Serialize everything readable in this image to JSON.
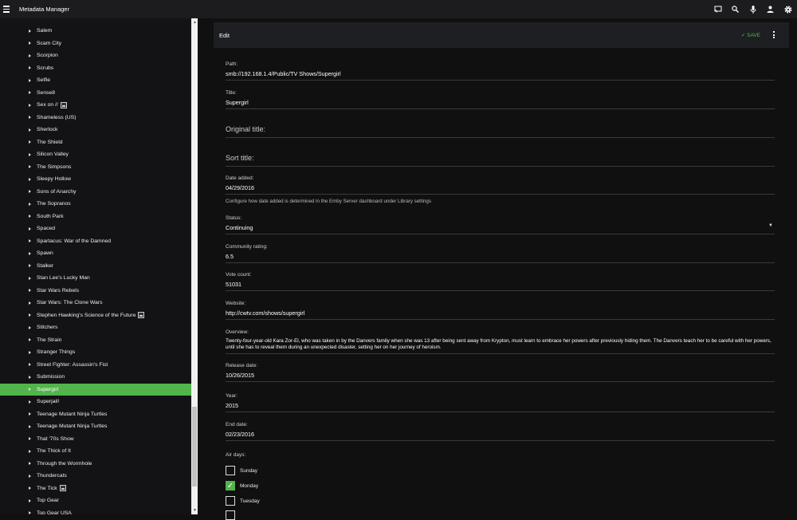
{
  "header": {
    "title": "Metadata Manager"
  },
  "sidebar": {
    "selected": "Supergirl",
    "items": [
      {
        "label": "Salem"
      },
      {
        "label": "Scam City"
      },
      {
        "label": "Scorpion"
      },
      {
        "label": "Scrubs"
      },
      {
        "label": "Selfie"
      },
      {
        "label": "Sense8"
      },
      {
        "label": "Sex on //",
        "img": true
      },
      {
        "label": "Shameless (US)"
      },
      {
        "label": "Sherlock"
      },
      {
        "label": "The Shield"
      },
      {
        "label": "Silicon Valley"
      },
      {
        "label": "The Simpsons"
      },
      {
        "label": "Sleepy Hollow"
      },
      {
        "label": "Sons of Anarchy"
      },
      {
        "label": "The Sopranos"
      },
      {
        "label": "South Park"
      },
      {
        "label": "Spaced"
      },
      {
        "label": "Spartacus: War of the Damned"
      },
      {
        "label": "Spawn"
      },
      {
        "label": "Stalker"
      },
      {
        "label": "Stan Lee's Lucky Man"
      },
      {
        "label": "Star Wars Rebels"
      },
      {
        "label": "Star Wars: The Clone Wars"
      },
      {
        "label": "Stephen Hawking's Science of the Future",
        "img": true
      },
      {
        "label": "Stitchers"
      },
      {
        "label": "The Strain"
      },
      {
        "label": "Stranger Things"
      },
      {
        "label": "Street Fighter: Assassin's Fist"
      },
      {
        "label": "Submission"
      },
      {
        "label": "Supergirl"
      },
      {
        "label": "Superjail!"
      },
      {
        "label": "Teenage Mutant Ninja Turtles"
      },
      {
        "label": "Teenage Mutant Ninja Turtles"
      },
      {
        "label": "That '70s Show"
      },
      {
        "label": "The Thick of It"
      },
      {
        "label": "Through the Wormhole"
      },
      {
        "label": "Thundercats"
      },
      {
        "label": "The Tick",
        "img": true
      },
      {
        "label": "Top Gear"
      },
      {
        "label": "Top Gear USA"
      }
    ]
  },
  "edit": {
    "title": "Edit",
    "save_label": "SAVE",
    "path_label": "Path:",
    "path": "smb://192.168.1.4/Public/TV Shows/Supergirl",
    "title_label": "Title:",
    "title_value": "Supergirl",
    "original_title_label": "Original title:",
    "sort_title_label": "Sort title:",
    "date_added_label": "Date added:",
    "date_added": "04/29/2016",
    "date_added_help": "Configure how date added is determined in the Emby Server dashboard under Library settings",
    "status_label": "Status:",
    "status": "Continuing",
    "rating_label": "Community rating:",
    "rating": "6.5",
    "votes_label": "Vote count:",
    "votes": "51031",
    "website_label": "Website:",
    "website": "http://cwtv.com/shows/supergirl",
    "overview_label": "Overview:",
    "overview": "Twenty-four-year-old Kara Zor-El, who was taken in by the Danvers family when she was 13 after being sent away from Krypton, must learn to embrace her powers after previously hiding them. The Danvers teach her to be careful with her powers, until she has to reveal them during an unexpected disaster, setting her on her journey of heroism.",
    "release_label": "Release date:",
    "release": "10/26/2015",
    "year_label": "Year:",
    "year": "2015",
    "end_label": "End date:",
    "end": "02/23/2016",
    "air_days_label": "Air days:",
    "air_days": [
      {
        "label": "Sunday",
        "checked": false
      },
      {
        "label": "Monday",
        "checked": true
      },
      {
        "label": "Tuesday",
        "checked": false
      }
    ]
  },
  "colors": {
    "accent": "#52b54b"
  }
}
